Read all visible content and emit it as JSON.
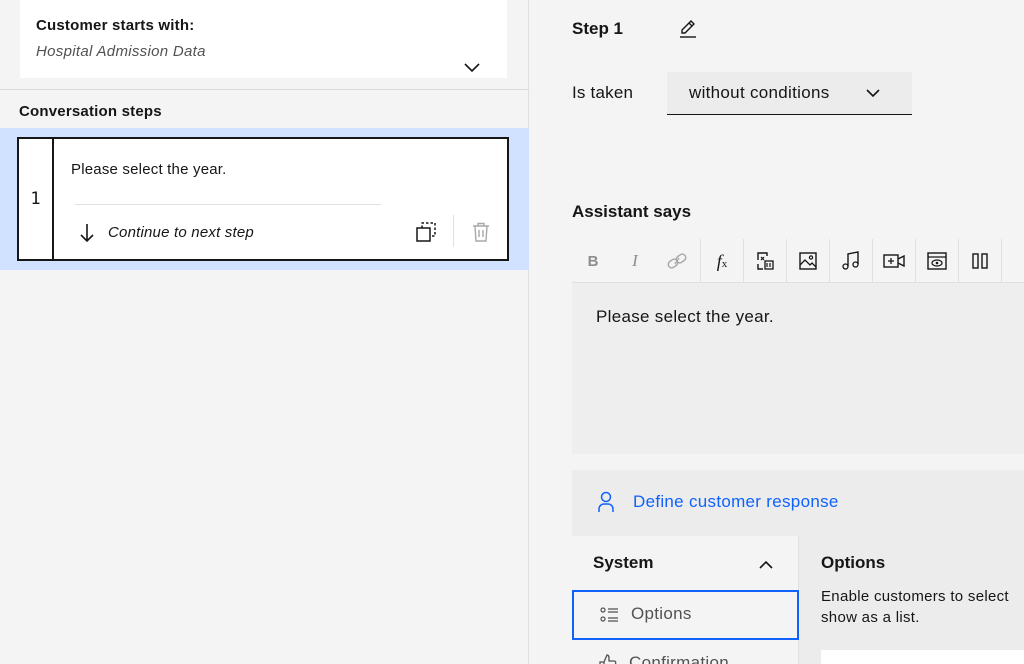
{
  "left_panel": {
    "customer_starts": {
      "title": "Customer starts with:",
      "value": "Hospital Admission Data",
      "expand_icon": "chevron-down-icon"
    },
    "steps_title": "Conversation steps",
    "steps": [
      {
        "number": "1",
        "text": "Please select the year.",
        "next_action": "Continue to next step",
        "next_icon": "arrow-down-icon",
        "actions": [
          "duplicate-icon",
          "trash-icon"
        ]
      }
    ]
  },
  "editor": {
    "step_title": "Step 1",
    "edit_icon": "pencil-icon",
    "taken_label": "Is taken",
    "condition_value": "without conditions",
    "assistant_title": "Assistant says",
    "toolbar_icons": [
      "bold-icon",
      "italic-icon",
      "link-icon",
      "function-icon",
      "variable-icon",
      "image-icon",
      "audio-icon",
      "video-icon",
      "iframe-icon",
      "columns-icon"
    ],
    "assistant_text": "Please select the year.",
    "response": {
      "define_label": "Define customer response",
      "person_icon": "user-icon",
      "system_title": "System",
      "system_items": [
        {
          "label": "Options",
          "icon": "options-list-icon",
          "selected": true
        },
        {
          "label": "Confirmation",
          "icon": "thumbs-up-icon",
          "selected": false
        }
      ],
      "options_title": "Options",
      "options_description_line1": "Enable customers to select",
      "options_description_line2": "show as a list."
    }
  },
  "colors": {
    "accent": "#0f62fe",
    "selected_row": "#d0e2ff",
    "text": "#161616",
    "background": "#f4f4f4"
  }
}
